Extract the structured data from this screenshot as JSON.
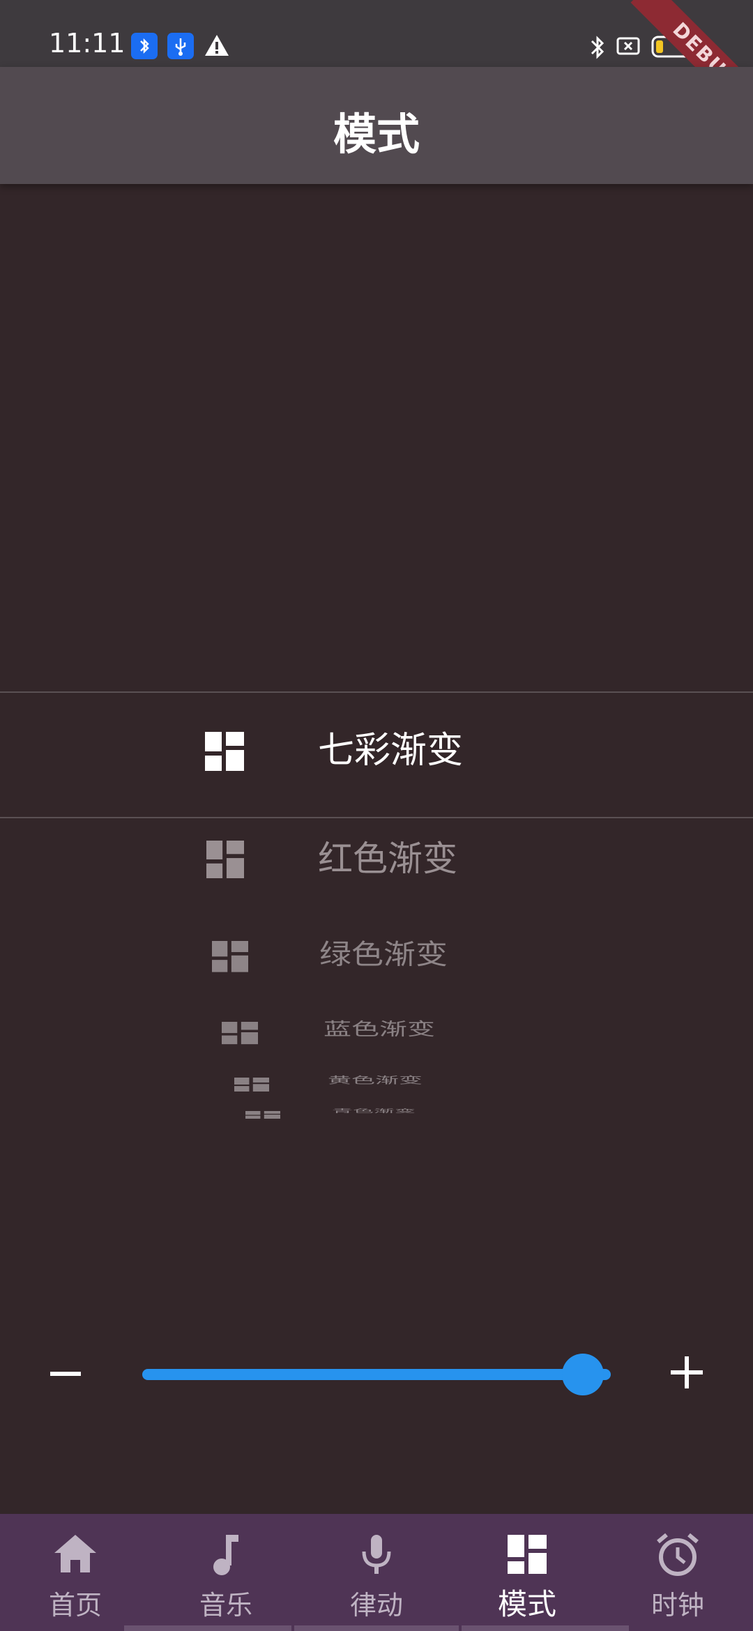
{
  "status_bar": {
    "time": "11:11",
    "left_icons": [
      "bluetooth-icon",
      "usb-icon",
      "warning-icon"
    ],
    "right_icons": [
      "bluetooth-icon",
      "sim-icon",
      "battery-icon"
    ]
  },
  "debug_banner": "DEBUG",
  "app_bar": {
    "title": "模式"
  },
  "picker": {
    "items": [
      {
        "label": "七彩渐变",
        "icon": "dashboard-icon"
      },
      {
        "label": "红色渐变",
        "icon": "dashboard-icon"
      },
      {
        "label": "绿色渐变",
        "icon": "dashboard-icon"
      },
      {
        "label": "蓝色渐变",
        "icon": "dashboard-icon"
      },
      {
        "label": "黄色渐变",
        "icon": "dashboard-icon"
      },
      {
        "label": "青色渐变",
        "icon": "dashboard-icon"
      }
    ],
    "selected_index": 0
  },
  "slider": {
    "value_fraction": 0.94,
    "minus_icon": "minus-icon",
    "plus_icon": "plus-icon",
    "color": "#2793ee"
  },
  "bottom_nav": {
    "items": [
      {
        "label": "首页",
        "icon": "home-icon"
      },
      {
        "label": "音乐",
        "icon": "music-note-icon"
      },
      {
        "label": "律动",
        "icon": "microphone-icon"
      },
      {
        "label": "模式",
        "icon": "dashboard-icon"
      },
      {
        "label": "时钟",
        "icon": "alarm-clock-icon"
      }
    ],
    "active_index": 3
  },
  "colors": {
    "background": "#332629",
    "app_bar": "#524a50",
    "bottom_nav": "#4f3455",
    "accent": "#2793ee"
  }
}
